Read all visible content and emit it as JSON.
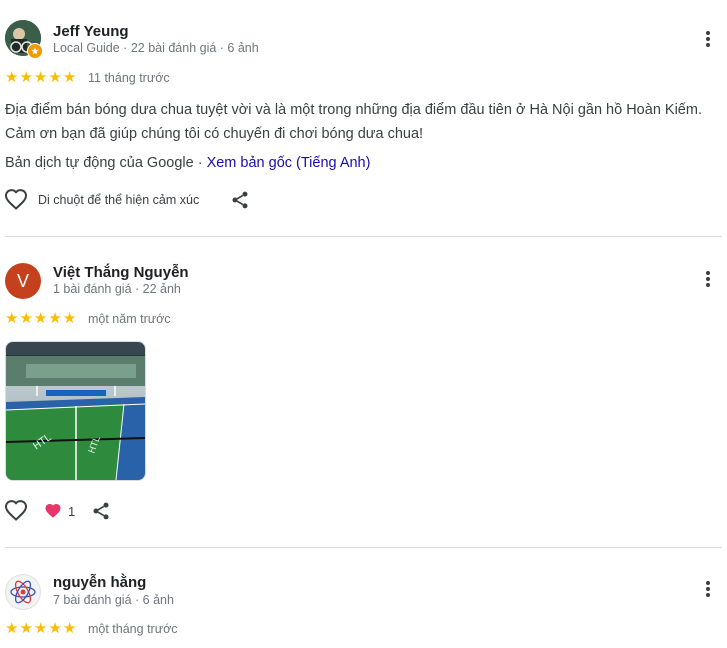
{
  "reviews": [
    {
      "name": "Jeff Yeung",
      "meta": "Local Guide · 22 bài đánh giá · 6 ảnh",
      "rating": 5,
      "date": "11 tháng trước",
      "text": "Địa điểm bán bóng dưa chua tuyệt vời và là một trong những địa điểm đầu tiên ở Hà Nội gần hồ Hoàn Kiếm. Cảm ơn bạn đã giúp chúng tôi có chuyến đi chơi bóng dưa chua!",
      "translation_prefix": "Bản dịch tự động của Google · ",
      "translation_link": "Xem bản gốc (Tiếng Anh)",
      "hover_hint": "Di chuột để thể hiện cảm xúc"
    },
    {
      "name": "Việt Thắng Nguyễn",
      "avatar_letter": "V",
      "meta": "1 bài đánh giá · 22 ảnh",
      "rating": 5,
      "date": "một năm trước",
      "reaction_count": "1"
    },
    {
      "name": "nguyễn hằng",
      "meta": "7 bài đánh giá · 6 ảnh",
      "rating": 5,
      "date": "một tháng trước"
    }
  ],
  "colors": {
    "star": "#fbbc04",
    "link": "#1a0dab",
    "avatar_v": "#c5401c",
    "reaction_heart": "#e8336b"
  },
  "icons": [
    "more-vert-icon",
    "heart-outline-icon",
    "share-icon",
    "heart-filled-icon",
    "local-guide-badge-icon",
    "atom-icon"
  ]
}
